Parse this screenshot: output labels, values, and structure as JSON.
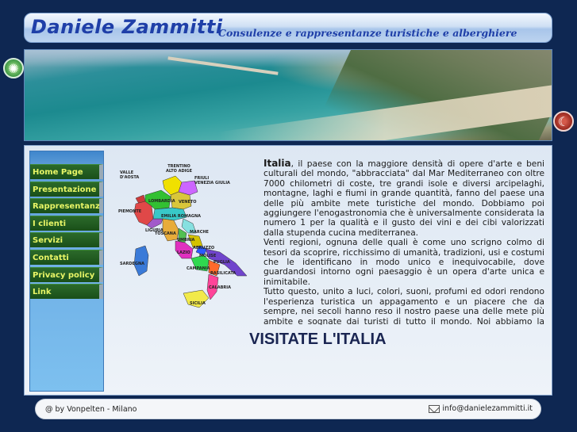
{
  "header": {
    "title": "Daniele Zammitti",
    "subtitle": "Consulenze e rappresentanze  turistiche e alberghiere"
  },
  "nav": {
    "items": [
      {
        "label": "Home Page"
      },
      {
        "label": "Presentazione"
      },
      {
        "label": "Rappresentanze"
      },
      {
        "label": "I clienti"
      },
      {
        "label": "Servizi"
      },
      {
        "label": "Contatti"
      },
      {
        "label": "Privacy policy"
      },
      {
        "label": "Link"
      }
    ]
  },
  "map": {
    "regions": [
      {
        "name": "TRENTINO ALTO ADIGE",
        "line1": "TRENTINO",
        "line2": "ALTO ADIGE",
        "color": "#f0e000"
      },
      {
        "name": "VALLE D'AOSTA",
        "line1": "VALLE",
        "line2": "D'AOSTA",
        "color": "#cc3a3a"
      },
      {
        "name": "LOMBARDIA",
        "color": "#32c032"
      },
      {
        "name": "FRIULI VENEZIA GIULIA",
        "line1": "FRIULI",
        "line2": "VENEZIA GIULIA",
        "color": "#cc66ff"
      },
      {
        "name": "VENETO",
        "color": "#d9c63a"
      },
      {
        "name": "PIEMONTE",
        "color": "#e04848"
      },
      {
        "name": "LIGURIA",
        "color": "#a25aca"
      },
      {
        "name": "EMILIA ROMAGNA",
        "color": "#38c8c8"
      },
      {
        "name": "TOSCANA",
        "color": "#e8ac3a"
      },
      {
        "name": "MARCHE",
        "color": "#86e0e0"
      },
      {
        "name": "UMBRIA",
        "color": "#52c052"
      },
      {
        "name": "ABRUZZO",
        "color": "#d4c200"
      },
      {
        "name": "LAZIO",
        "color": "#e030c0"
      },
      {
        "name": "MOLISE",
        "color": "#2a5aff"
      },
      {
        "name": "PUGLIA",
        "color": "#7044cc"
      },
      {
        "name": "CAMPANIA",
        "color": "#2fd84f"
      },
      {
        "name": "BASILICATA",
        "color": "#ff6a2a"
      },
      {
        "name": "CALABRIA",
        "color": "#ff4499"
      },
      {
        "name": "SARDEGNA",
        "color": "#3a7ad8"
      },
      {
        "name": "SICILIA",
        "color": "#f2ea4a"
      }
    ]
  },
  "article": {
    "lead": "Italia",
    "p1": ", il paese con la maggiore densità di opere d'arte e beni culturali del mondo, \"abbracciata\" dal Mar Mediterraneo con oltre 7000 chilometri di coste, tre grandi isole e diversi arcipelaghi, montagne, laghi e fiumi in grande quantità, fanno del paese una delle più ambite mete turistiche del mondo. Dobbiamo poi aggiungere l'enogastronomia che è universalmente considerata la numero 1 per la qualità e il gusto dei vini e dei cibi valorizzati dalla stupenda cucina mediterranea.",
    "p2": "Venti regioni, ognuna delle quali è come uno scrigno colmo di tesori da scoprire, ricchissimo di umanità, tradizioni, usi e costumi che le identificano in modo unico e inequivocabile, dove guardandosi intorno ogni paesaggio è un opera d'arte unica e inimitabile.",
    "p3": "Tutto questo, unito a luci, colori, suoni, profumi ed odori rendono l'esperienza turistica un appagamento e un piacere che da sempre, nei secoli hanno reso il nostro paese una delle mete più ambite e sognate dai turisti di tutto il mondo. Noi abbiamo la fortuna di esserci nati e di viverci."
  },
  "cta": "VISITATE L'ITALIA",
  "footer": {
    "credit": "@ by Vonpelten - Milano",
    "email": "info@danielezammitti.it"
  },
  "icons": {
    "sun": "sun-icon",
    "moon": "moon-icon",
    "mail": "mail-icon"
  }
}
